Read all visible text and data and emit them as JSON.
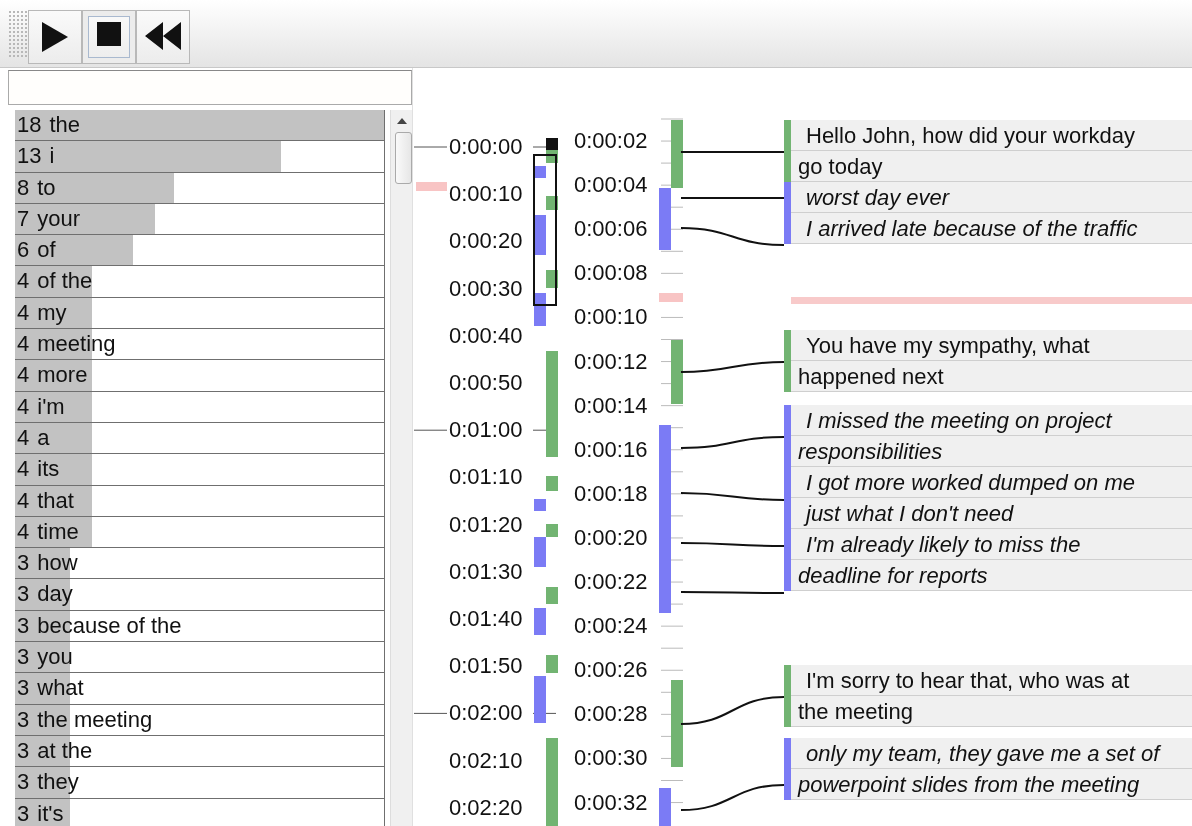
{
  "toolbar": {
    "buttons": [
      {
        "kind": "play",
        "selected": false
      },
      {
        "kind": "stop",
        "selected": true
      },
      {
        "kind": "rewind",
        "selected": false
      }
    ]
  },
  "word_counts": [
    {
      "count": "18",
      "phrase": "the",
      "level": 1
    },
    {
      "count": "13",
      "phrase": "i",
      "level": 0.72
    },
    {
      "count": "8",
      "phrase": "to",
      "level": 0.43
    },
    {
      "count": "7",
      "phrase": "your",
      "level": 0.38
    },
    {
      "count": "6",
      "phrase": "of",
      "level": 0.32
    },
    {
      "count": "4",
      "phrase": "of the",
      "level": 0.21
    },
    {
      "count": "4",
      "phrase": "my",
      "level": 0.21
    },
    {
      "count": "4",
      "phrase": "meeting",
      "level": 0.21
    },
    {
      "count": "4",
      "phrase": "more",
      "level": 0.21
    },
    {
      "count": "4",
      "phrase": "i'm",
      "level": 0.21
    },
    {
      "count": "4",
      "phrase": "a",
      "level": 0.21
    },
    {
      "count": "4",
      "phrase": "its",
      "level": 0.21
    },
    {
      "count": "4",
      "phrase": "that",
      "level": 0.21
    },
    {
      "count": "4",
      "phrase": "time",
      "level": 0.21
    },
    {
      "count": "3",
      "phrase": "how",
      "level": 0.15
    },
    {
      "count": "3",
      "phrase": "day",
      "level": 0.15
    },
    {
      "count": "3",
      "phrase": "because of the",
      "level": 0.15
    },
    {
      "count": "3",
      "phrase": "you",
      "level": 0.15
    },
    {
      "count": "3",
      "phrase": "what",
      "level": 0.15
    },
    {
      "count": "3",
      "phrase": "the meeting",
      "level": 0.15
    },
    {
      "count": "3",
      "phrase": "at the",
      "level": 0.15
    },
    {
      "count": "3",
      "phrase": "they",
      "level": 0.15
    },
    {
      "count": "3",
      "phrase": "it's",
      "level": 0.15
    }
  ],
  "overview_timeline": {
    "labels": [
      "0:00:00",
      "0:00:10",
      "0:00:20",
      "0:00:30",
      "0:00:40",
      "0:00:50",
      "0:01:00",
      "0:01:10",
      "0:01:20",
      "0:01:30",
      "0:01:40",
      "0:01:50",
      "0:02:00",
      "0:02:10",
      "0:02:20"
    ]
  },
  "detail_timeline": {
    "labels": [
      "0:00:02",
      "0:00:04",
      "0:00:06",
      "0:00:08",
      "0:00:10",
      "0:00:12",
      "0:00:14",
      "0:00:16",
      "0:00:18",
      "0:00:20",
      "0:00:22",
      "0:00:24",
      "0:00:26",
      "0:00:28",
      "0:00:30",
      "0:00:32"
    ]
  },
  "transcript": {
    "turns": [
      {
        "kind": "speaker-1",
        "utterances": [
          "Hello John, how did your workday go today"
        ]
      },
      {
        "kind": "speaker-2",
        "utterances": [
          "worst day ever",
          "I arrived late because of the traffic"
        ]
      },
      {
        "kind": "speaker-1",
        "utterances": [
          "You have my sympathy, what happened next"
        ]
      },
      {
        "kind": "speaker-2",
        "utterances": [
          "I missed the meeting on project responsibilities",
          "I got more worked dumped on me",
          "just what I don't need",
          "I'm already likely to miss the deadline for reports"
        ]
      },
      {
        "kind": "speaker-1",
        "utterances": [
          "I'm sorry to hear that, who was at the meeting"
        ]
      },
      {
        "kind": "speaker-2",
        "utterances": [
          "only my team, they gave me a set of powerpoint slides from the meeting"
        ]
      }
    ]
  }
}
